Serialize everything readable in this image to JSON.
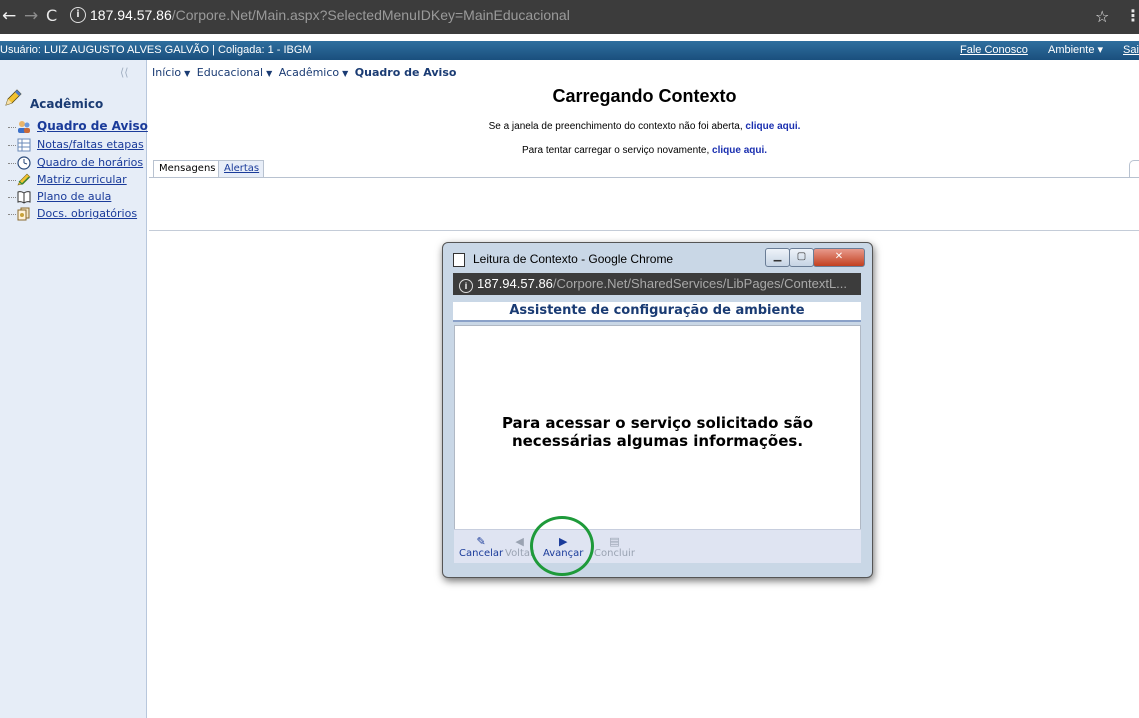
{
  "browser": {
    "url_host": "187.94.57.86",
    "url_path": "/Corpore.Net/Main.aspx?SelectedMenuIDKey=MainEducacional"
  },
  "user_bar": {
    "user_info": "Usuário: LUIZ AUGUSTO ALVES GALVÃO  |  Coligada: 1 - IBGM",
    "fale_conosco": "Fale Conosco",
    "ambiente": "Ambiente ▾",
    "sair": "Sair"
  },
  "left_panel": {
    "title": "Acadêmico",
    "items": [
      {
        "label": "Quadro de Aviso",
        "icon": "people-icon"
      },
      {
        "label": "Notas/faltas etapas",
        "icon": "grid-icon"
      },
      {
        "label": "Quadro de horários",
        "icon": "clock-icon"
      },
      {
        "label": "Matriz curricular",
        "icon": "pencil-check-icon"
      },
      {
        "label": "Plano de aula",
        "icon": "book-icon"
      },
      {
        "label": "Docs. obrigatórios",
        "icon": "documents-icon"
      }
    ]
  },
  "breadcrumb": {
    "inicio": "Início",
    "educacional": "Educacional",
    "academico": "Acadêmico",
    "current": "Quadro de Aviso"
  },
  "main": {
    "title": "Carregando Contexto",
    "line1_text": "Se a janela de preenchimento do contexto não foi aberta, ",
    "line1_link": "clique aqui.",
    "line2_text": "Para tentar carregar o serviço novamente, ",
    "line2_link": "clique aqui.",
    "tabs": [
      {
        "label": "Mensagens"
      },
      {
        "label": "Alertas"
      }
    ]
  },
  "popup": {
    "title": "Leitura de Contexto - Google Chrome",
    "url_host": "187.94.57.86",
    "url_path": "/Corpore.Net/SharedServices/LibPages/ContextL...",
    "header": "Assistente de configuração de ambiente",
    "message": "Para acessar o serviço solicitado são necessárias algumas informações.",
    "buttons": {
      "cancelar": "Cancelar",
      "voltar": "Voltar",
      "avancar": "Avançar",
      "concluir": "Concluir"
    }
  },
  "colors": {
    "user_bar": "#1a4f7d",
    "link": "#1a3b9a",
    "highlight_circle": "#1e9a3a"
  }
}
